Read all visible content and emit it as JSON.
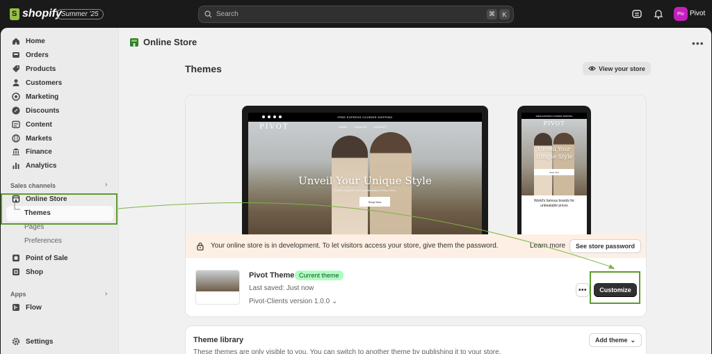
{
  "topbar": {
    "logo_text": "shopify",
    "edition_badge": "Summer '25",
    "search_placeholder": "Search",
    "shortcut_keys": [
      "⌘",
      "K"
    ],
    "avatar_initials": "Piv",
    "store_name": "Pivot",
    "avatar_color": "#c51fbd"
  },
  "sidebar": {
    "items": [
      {
        "label": "Home",
        "icon": "home-icon"
      },
      {
        "label": "Orders",
        "icon": "inbox-icon"
      },
      {
        "label": "Products",
        "icon": "tag-icon"
      },
      {
        "label": "Customers",
        "icon": "person-icon"
      },
      {
        "label": "Marketing",
        "icon": "target-icon"
      },
      {
        "label": "Discounts",
        "icon": "discount-icon"
      },
      {
        "label": "Content",
        "icon": "content-icon"
      },
      {
        "label": "Markets",
        "icon": "globe-icon"
      },
      {
        "label": "Finance",
        "icon": "bank-icon"
      },
      {
        "label": "Analytics",
        "icon": "chart-icon"
      }
    ],
    "sales_channels_label": "Sales channels",
    "online_store_label": "Online Store",
    "online_store_sub": [
      "Themes",
      "Pages",
      "Preferences"
    ],
    "channels": [
      {
        "label": "Point of Sale",
        "icon": "pos-icon"
      },
      {
        "label": "Shop",
        "icon": "shop-icon"
      }
    ],
    "apps_label": "Apps",
    "apps": [
      {
        "label": "Flow",
        "icon": "flow-icon"
      }
    ],
    "settings_label": "Settings"
  },
  "main": {
    "header_title": "Online Store",
    "page_title": "Themes",
    "view_store_label": "View your store",
    "preview": {
      "announcement": "FREE EXPRESS COURIER SHIPPING",
      "brand": "PIVOT",
      "nav_links": [
        "HOME",
        "CATALOG",
        "CONTACT"
      ],
      "hero_heading": "Unveil Your Unique Style",
      "hero_sub": "Quality, elegance, and sustainability in every stitch.",
      "hero_button": "Shop Now",
      "phone_heading_line1": "Unveil Your",
      "phone_heading_line2": "Unique Style",
      "phone_caption": "World's famous brands for unbeatable prices"
    },
    "dev_banner": {
      "text": "Your online store is in development. To let visitors access your store, give them the password.",
      "learn_more": "Learn more",
      "button": "See store password"
    },
    "current_theme": {
      "name": "Pivot Theme",
      "badge": "Current theme",
      "last_saved": "Last saved: Just now",
      "version": "Pivot-Clients version 1.0.0",
      "customize_label": "Customize"
    },
    "library": {
      "title": "Theme library",
      "description": "These themes are only visible to you. You can switch to another theme by publishing it to your store.",
      "add_theme_label": "Add theme"
    }
  },
  "colors": {
    "annotation": "#5a9a2a",
    "badge_bg": "#affebf",
    "banner_bg": "#fdefe3"
  }
}
